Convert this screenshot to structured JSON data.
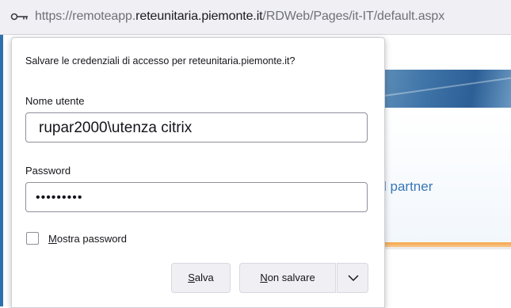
{
  "address_bar": {
    "url_prefix": "https://remoteapp.",
    "url_host": "reteunitaria.piemonte.it",
    "url_path": "/RDWeb/Pages/it-IT/default.aspx",
    "icon": "key-icon"
  },
  "background_page": {
    "partner_text": "l partner"
  },
  "dialog": {
    "title": "Salvare le credenziali di accesso per reteunitaria.piemonte.it?",
    "username_label": "Nome utente",
    "username_value": "rupar2000\\utenza citrix",
    "password_label": "Password",
    "password_value": "•••••••••",
    "show_password": {
      "checked": false,
      "label_first": "M",
      "label_rest": "ostra password"
    },
    "buttons": {
      "save_first": "S",
      "save_rest": "alva",
      "nosave_first": "N",
      "nosave_rest": "on salvare",
      "more_icon": "chevron-down-icon"
    }
  },
  "colors": {
    "accent_blue": "#3876b8",
    "orange_bar": "#f5a64a",
    "button_bg": "#f0f0f4"
  }
}
